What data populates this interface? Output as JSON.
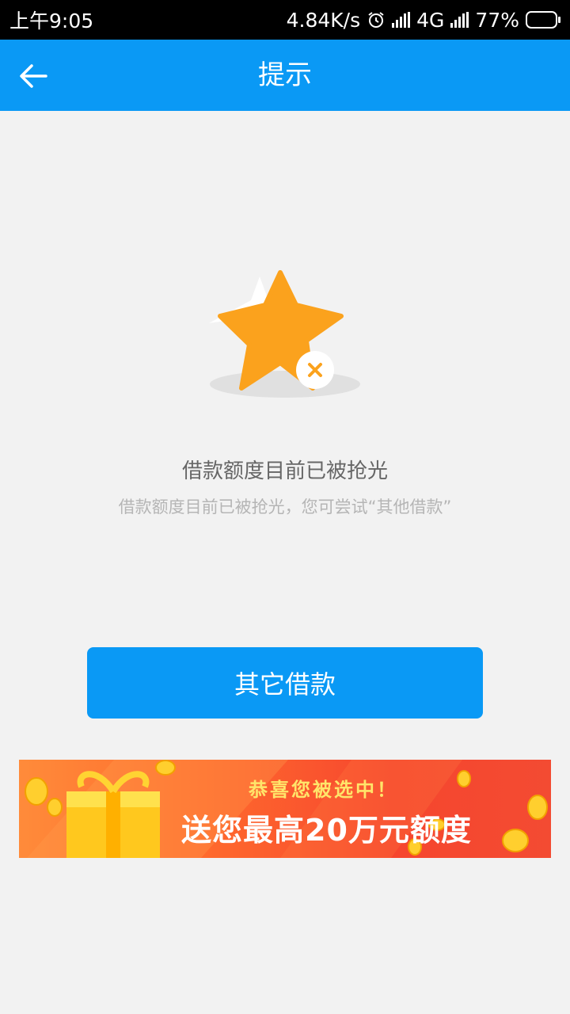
{
  "status_bar": {
    "time": "上午9:05",
    "net_speed": "4.84K/s",
    "network": "4G",
    "battery": "77%",
    "battery_level": 0.77
  },
  "nav": {
    "title": "提示"
  },
  "empty_state": {
    "headline": "借款额度目前已被抢光",
    "subline": "借款额度目前已被抢光，您可尝试“其他借款”"
  },
  "button": {
    "label": "其它借款"
  },
  "banner": {
    "line1": "恭喜您被选中！",
    "line2": "送您最高20万元额度"
  },
  "colors": {
    "primary": "#0a99f5",
    "star": "#fba21d",
    "banner_yellow": "#ffe56a"
  }
}
